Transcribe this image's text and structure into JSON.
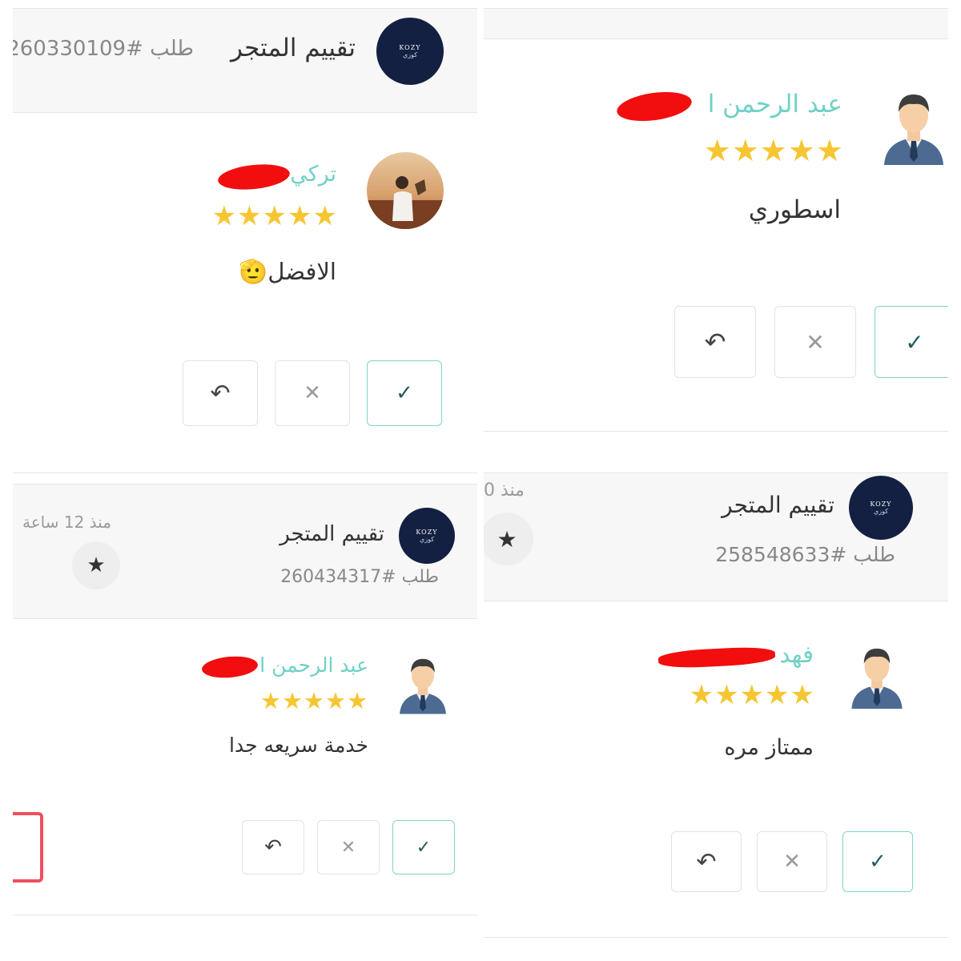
{
  "brand": {
    "name_latin": "KOZY",
    "name_arabic": "كوزي"
  },
  "colors": {
    "accent": "#6fd1c6",
    "star": "#f6c632",
    "logo_bg": "#132041",
    "redaction": "#f20e0e"
  },
  "panel_tl": {
    "title": "تقييم المتجر",
    "order": "طلب #260330109",
    "review": {
      "name": "تركي",
      "stars": "★★★★★",
      "comment": "الافضل🫡"
    },
    "buttons": {
      "check": "✓",
      "close": "✕",
      "reply": "↶"
    }
  },
  "panel_tr": {
    "review": {
      "name": "عبد الرحمن ا",
      "stars": "★★★★★",
      "comment": "اسطوري"
    },
    "buttons": {
      "check": "✓",
      "close": "✕",
      "reply": "↶"
    }
  },
  "panel_bl": {
    "title": "تقييم المتجر",
    "order": "طلب #260434317",
    "since": "منذ 12 ساعة",
    "star_icon": "★",
    "review": {
      "name": "عبد الرحمن ا",
      "stars": "★★★★★",
      "comment": "خدمة سريعه جدا"
    },
    "buttons": {
      "check": "✓",
      "close": "✕",
      "reply": "↶"
    }
  },
  "panel_br": {
    "title": "تقييم المتجر",
    "order": "طلب #258548633",
    "since": "منذ 0",
    "star_icon": "★",
    "review": {
      "name": "فهد",
      "stars": "★★★★★",
      "comment": "ممتاز مره"
    },
    "buttons": {
      "check": "✓",
      "close": "✕",
      "reply": "↶"
    }
  }
}
